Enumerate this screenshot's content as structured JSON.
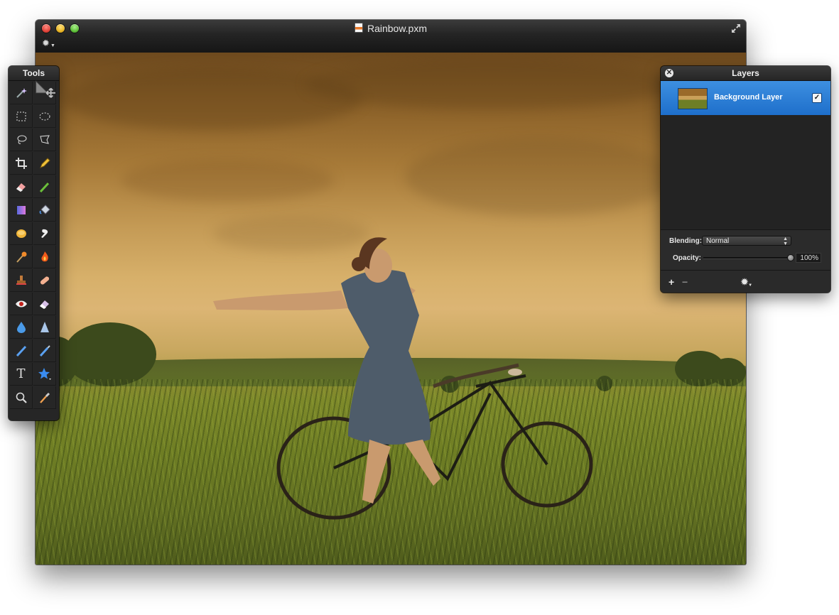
{
  "window": {
    "title": "Rainbow.pxm"
  },
  "tools_panel": {
    "title": "Tools",
    "tools": [
      {
        "name": "magic-wand-tool",
        "icon": "magic-wand-icon"
      },
      {
        "name": "arrange-tool",
        "icon": "move-arrow-icon",
        "selected": true
      },
      {
        "name": "rectangular-select-tool",
        "icon": "rect-select-icon"
      },
      {
        "name": "elliptical-select-tool",
        "icon": "ellipse-select-icon"
      },
      {
        "name": "lasso-tool",
        "icon": "lasso-icon"
      },
      {
        "name": "polygonal-lasso-tool",
        "icon": "polygon-lasso-icon"
      },
      {
        "name": "crop-tool",
        "icon": "crop-icon"
      },
      {
        "name": "pencil-tool",
        "icon": "pencil-icon"
      },
      {
        "name": "eraser-tool",
        "icon": "eraser-icon"
      },
      {
        "name": "brush-tool",
        "icon": "brush-icon"
      },
      {
        "name": "gradient-tool",
        "icon": "gradient-icon"
      },
      {
        "name": "paint-bucket-tool",
        "icon": "paint-bucket-icon"
      },
      {
        "name": "sponge-tool",
        "icon": "sponge-icon"
      },
      {
        "name": "smudge-tool",
        "icon": "smudge-icon"
      },
      {
        "name": "dodge-tool",
        "icon": "dodge-icon"
      },
      {
        "name": "burn-tool",
        "icon": "burn-icon"
      },
      {
        "name": "clone-stamp-tool",
        "icon": "stamp-icon"
      },
      {
        "name": "heal-tool",
        "icon": "bandage-icon"
      },
      {
        "name": "red-eye-tool",
        "icon": "eye-icon"
      },
      {
        "name": "repair-eraser-tool",
        "icon": "eraser-alt-icon"
      },
      {
        "name": "blur-tool",
        "icon": "droplet-icon"
      },
      {
        "name": "sharpen-tool",
        "icon": "cone-icon"
      },
      {
        "name": "pen-tool",
        "icon": "pen-icon"
      },
      {
        "name": "freeform-pen-tool",
        "icon": "pen-alt-icon"
      },
      {
        "name": "type-tool",
        "icon": "type-icon",
        "label": "T"
      },
      {
        "name": "shape-tool",
        "icon": "star-icon"
      },
      {
        "name": "zoom-tool",
        "icon": "magnifier-icon"
      },
      {
        "name": "eyedropper-tool",
        "icon": "eyedropper-icon"
      }
    ]
  },
  "layers_panel": {
    "title": "Layers",
    "close_label": "✕",
    "layers": [
      {
        "name": "Background Layer",
        "visible": true,
        "selected": true
      }
    ],
    "blending_label": "Blending:",
    "blending_value": "Normal",
    "opacity_label": "Opacity:",
    "opacity_value": "100%",
    "opacity_fraction": 1.0,
    "add_label": "+",
    "remove_label": "−"
  },
  "colors": {
    "selection_blue": "#1e6fcb",
    "panel_bg": "#262626"
  }
}
